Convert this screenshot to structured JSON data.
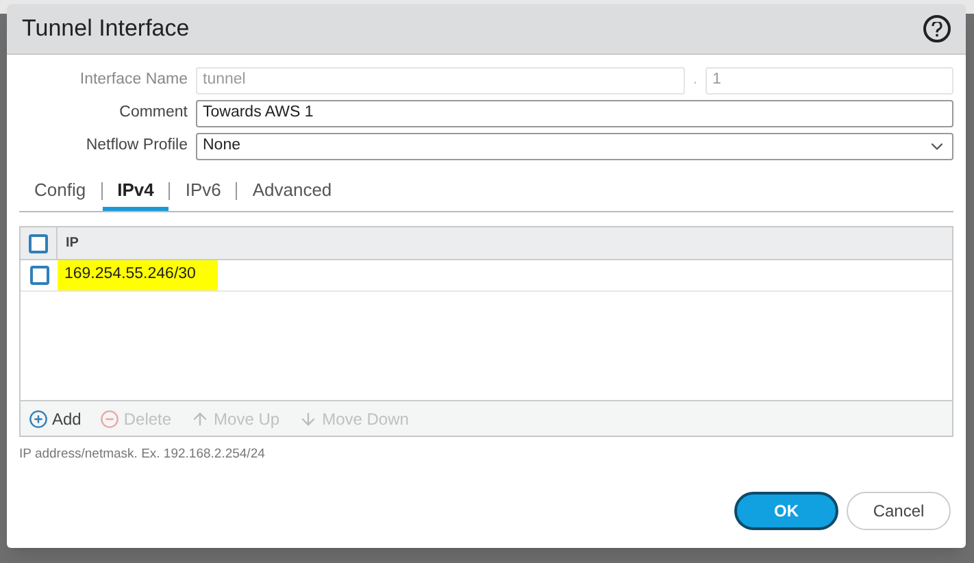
{
  "dialog": {
    "title": "Tunnel Interface"
  },
  "fields": [
    {
      "label": "Interface Name",
      "kind": "split",
      "value": "tunnel",
      "separator": ".",
      "suffix": "1",
      "disabled": true
    },
    {
      "label": "Comment",
      "kind": "text",
      "value": "Towards AWS 1",
      "disabled": false
    },
    {
      "label": "Netflow Profile",
      "kind": "select",
      "value": "None",
      "disabled": false
    }
  ],
  "tabs": [
    {
      "label": "Config",
      "selected": false
    },
    {
      "label": "IPv4",
      "selected": true
    },
    {
      "label": "IPv6",
      "selected": false
    },
    {
      "label": "Advanced",
      "selected": false
    }
  ],
  "table": {
    "columns": [
      "IP"
    ],
    "header_checked": false,
    "rows": [
      {
        "ip": "169.254.55.246/30",
        "checked": false,
        "highlighted": true
      }
    ]
  },
  "toolbar": [
    {
      "kind": "add",
      "label": "Add",
      "disabled": false
    },
    {
      "kind": "delete",
      "label": "Delete",
      "disabled": true
    },
    {
      "kind": "up",
      "label": "Move Up",
      "disabled": true
    },
    {
      "kind": "down",
      "label": "Move Down",
      "disabled": true
    }
  ],
  "hint": "IP address/netmask. Ex. 192.168.2.254/24",
  "buttons": [
    {
      "label": "OK",
      "kind": "primary"
    },
    {
      "label": "Cancel",
      "kind": "secondary"
    }
  ]
}
